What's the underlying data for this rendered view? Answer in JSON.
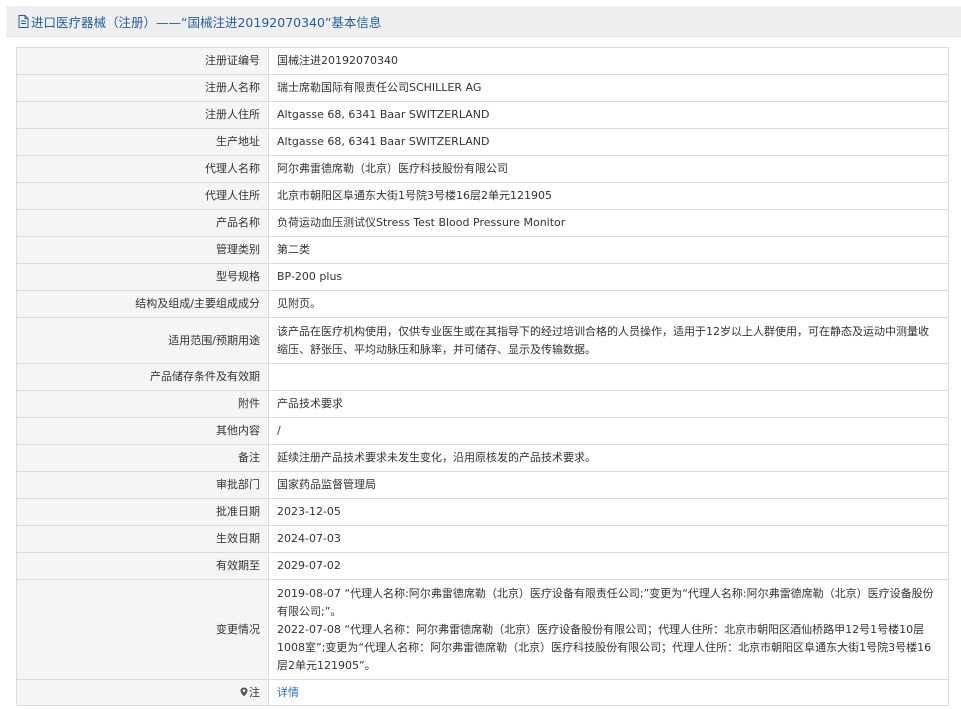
{
  "header": {
    "icon": "document-icon",
    "title": "进口医疗器械（注册）——“国械注进20192070340”基本信息"
  },
  "rows": [
    {
      "label": "注册证编号",
      "value": "国械注进20192070340"
    },
    {
      "label": "注册人名称",
      "value": "瑞士席勒国际有限责任公司SCHILLER AG"
    },
    {
      "label": "注册人住所",
      "value": "Altgasse 68, 6341 Baar SWITZERLAND"
    },
    {
      "label": "生产地址",
      "value": "Altgasse 68, 6341 Baar SWITZERLAND"
    },
    {
      "label": "代理人名称",
      "value": "阿尔弗雷德席勒（北京）医疗科技股份有限公司"
    },
    {
      "label": "代理人住所",
      "value": "北京市朝阳区阜通东大街1号院3号楼16层2单元121905"
    },
    {
      "label": "产品名称",
      "value": "负荷运动血压测试仪Stress Test Blood Pressure Monitor"
    },
    {
      "label": "管理类别",
      "value": "第二类"
    },
    {
      "label": "型号规格",
      "value": "BP-200 plus"
    },
    {
      "label": "结构及组成/主要组成成分",
      "value": "见附页。"
    },
    {
      "label": "适用范围/预期用途",
      "value": "该产品在医疗机构使用，仅供专业医生或在其指导下的经过培训合格的人员操作，适用于12岁以上人群使用，可在静态及运动中测量收缩压、舒张压、平均动脉压和脉率，并可储存、显示及传输数据。"
    },
    {
      "label": "产品储存条件及有效期",
      "value": ""
    },
    {
      "label": "附件",
      "value": "产品技术要求"
    },
    {
      "label": "其他内容",
      "value": "/"
    },
    {
      "label": "备注",
      "value": "延续注册产品技术要求未发生变化，沿用原核发的产品技术要求。"
    },
    {
      "label": "审批部门",
      "value": "国家药品监督管理局"
    },
    {
      "label": "批准日期",
      "value": "2023-12-05"
    },
    {
      "label": "生效日期",
      "value": "2024-07-03"
    },
    {
      "label": "有效期至",
      "value": "2029-07-02"
    }
  ],
  "changes": {
    "label": "变更情况",
    "entries": [
      "2019-08-07 “代理人名称:阿尔弗雷德席勒（北京）医疗设备有限责任公司;”变更为“代理人名称:阿尔弗雷德席勒（北京）医疗设备股份有限公司;”。",
      "2022-07-08 “代理人名称：阿尔弗雷德席勒（北京）医疗设备股份有限公司；代理人住所：北京市朝阳区酒仙桥路甲12号1号楼10层1008室”;变更为“代理人名称：阿尔弗雷德席勒（北京）医疗科技股份有限公司；代理人住所：北京市朝阳区阜通东大街1号院3号楼16层2单元121905”。"
    ]
  },
  "note": {
    "label": "注",
    "icon": "map-pin-icon",
    "link_text": "详情"
  }
}
